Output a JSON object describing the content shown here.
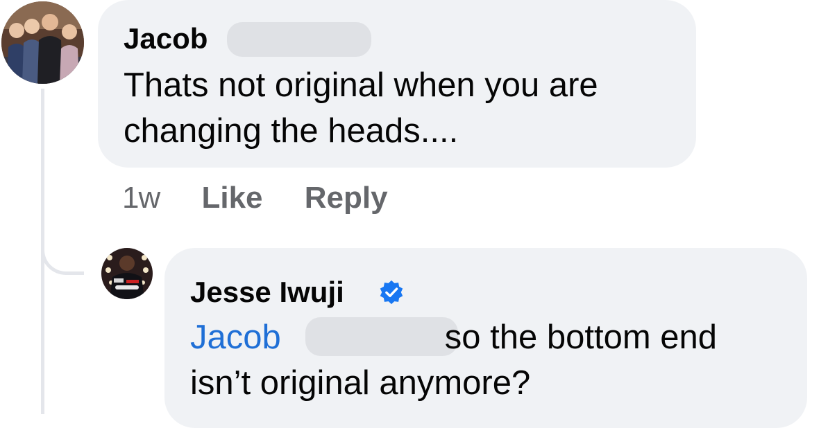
{
  "comments": [
    {
      "author": "Jacob",
      "text": "Thats not original when you are changing the heads....",
      "text_lines": [
        "Thats not original when you are",
        "changing the heads...."
      ],
      "timestamp": "1w",
      "like_label": "Like",
      "reply_label": "Reply",
      "author_redacted": true
    },
    {
      "author": "Jesse Iwuji",
      "verified": true,
      "mention": "Jacob",
      "text_line1_after_mention": "so the bottom end",
      "text_line2": "isn’t original anymore?"
    }
  ],
  "colors": {
    "bubble_bg": "#f0f2f5",
    "mention": "#1f6fd6",
    "secondary_text": "#65676b",
    "verified_badge": "#1877f2",
    "thread_line": "#e4e6eb"
  },
  "icons": {
    "verified": "verified-badge-icon"
  }
}
